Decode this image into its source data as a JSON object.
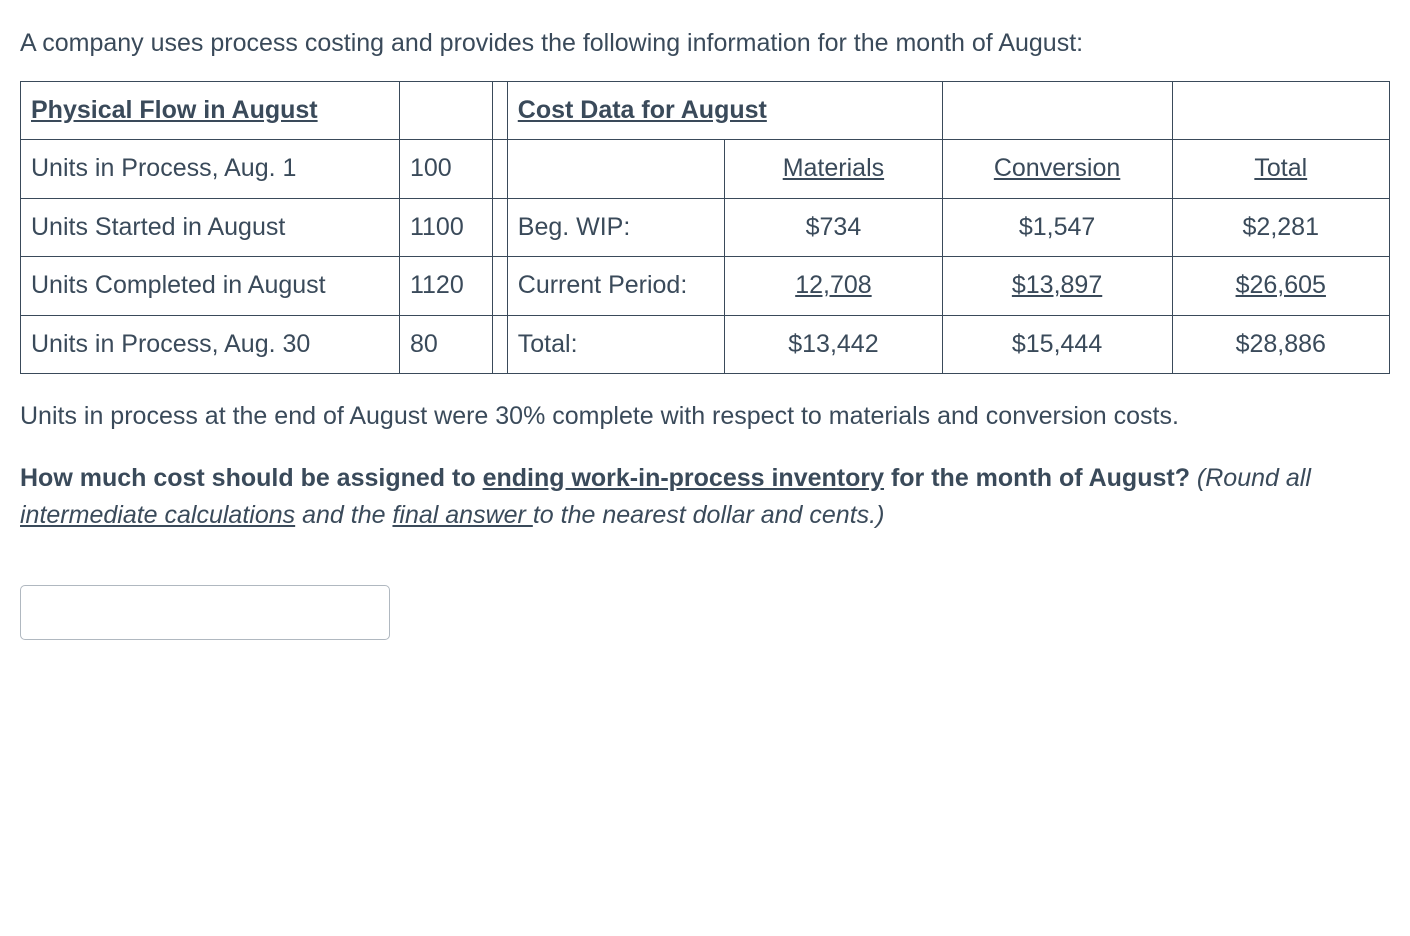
{
  "intro": "A company uses process costing and provides the following information for the month of August:",
  "headers": {
    "physical_flow": "Physical Flow in August",
    "cost_data": "Cost Data for August",
    "materials": "Materials",
    "conversion": "Conversion",
    "total": "Total"
  },
  "physical": {
    "units_in_process_aug1": {
      "label": "Units in Process, Aug. 1",
      "value": "100"
    },
    "units_started": {
      "label": "Units Started in August",
      "value": "1100"
    },
    "units_completed": {
      "label": "Units Completed in August",
      "value": "1120"
    },
    "units_in_process_aug30": {
      "label": "Units in Process, Aug. 30",
      "value": "80"
    }
  },
  "cost": {
    "beg_wip": {
      "label": "Beg. WIP:",
      "materials": "$734",
      "conversion": "$1,547",
      "total": "$2,281"
    },
    "current": {
      "label": "Current Period:",
      "materials": "12,708",
      "conversion": "$13,897",
      "total": "$26,605"
    },
    "total_row": {
      "label": "Total:",
      "materials": "$13,442",
      "conversion": "$15,444",
      "total": "$28,886"
    }
  },
  "after_table": "Units in process at the end of August were 30% complete with respect to materials and conversion costs.",
  "question": {
    "bold_start": "How much cost should be assigned to ",
    "bold_underline": "ending work-in-process inventory",
    "bold_end": " for the month of August?",
    "italic_start": "  (Round all ",
    "italic_u1": "intermediate calculations",
    "italic_mid": " and the ",
    "italic_u2": "final answer ",
    "italic_end": "to the nearest dollar and cents.)"
  },
  "chart_data": {
    "type": "table",
    "physical_flow": [
      {
        "label": "Units in Process, Aug. 1",
        "value": 100
      },
      {
        "label": "Units Started in August",
        "value": 1100
      },
      {
        "label": "Units Completed in August",
        "value": 1120
      },
      {
        "label": "Units in Process, Aug. 30",
        "value": 80
      }
    ],
    "cost_data": {
      "columns": [
        "Materials",
        "Conversion",
        "Total"
      ],
      "rows": [
        {
          "label": "Beg. WIP:",
          "materials": 734,
          "conversion": 1547,
          "total": 2281
        },
        {
          "label": "Current Period:",
          "materials": 12708,
          "conversion": 13897,
          "total": 26605
        },
        {
          "label": "Total:",
          "materials": 13442,
          "conversion": 15444,
          "total": 28886
        }
      ]
    },
    "ending_wip_pct_complete": 0.3
  }
}
